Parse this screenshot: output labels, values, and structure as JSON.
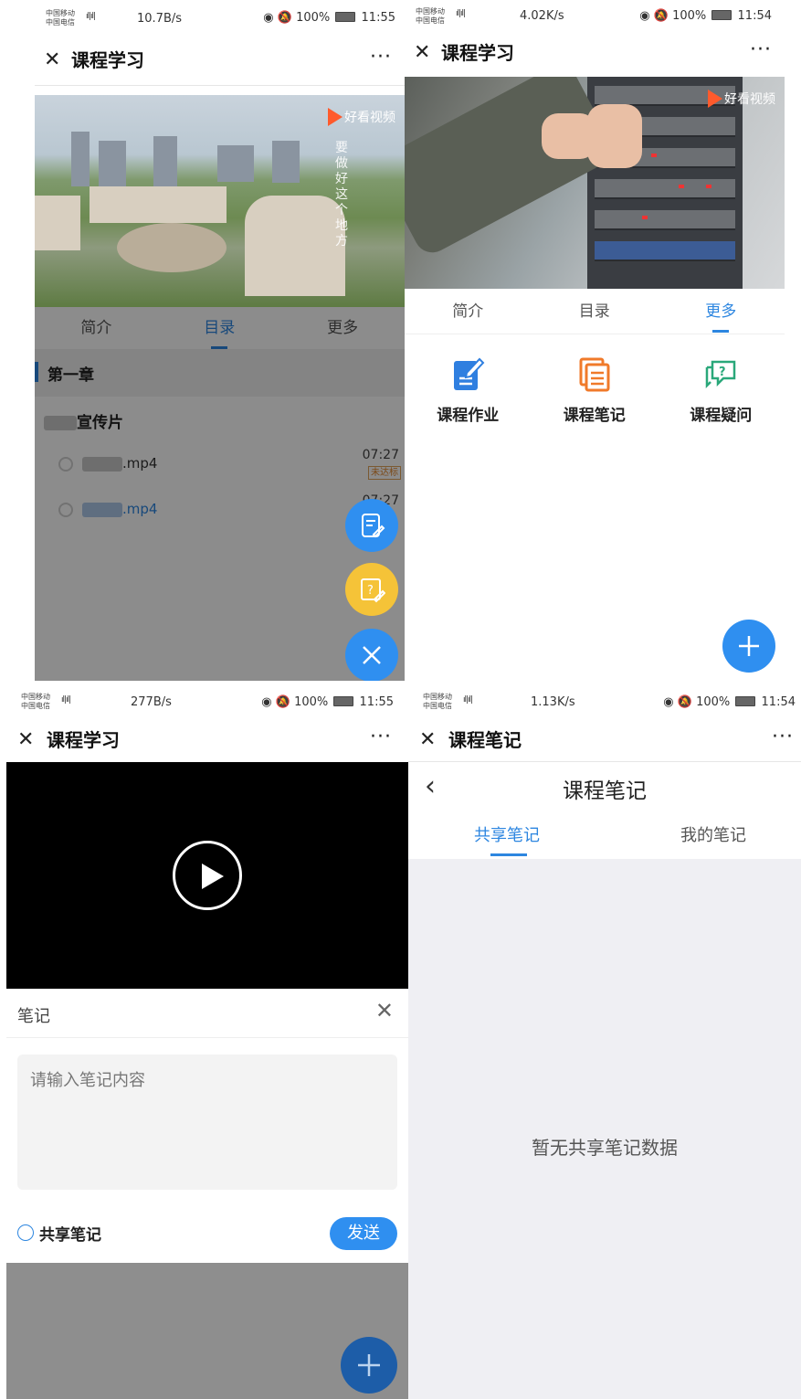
{
  "common": {
    "carrier_line1": "中国移动",
    "carrier_line2": "中国电信",
    "signal1": "2G",
    "signal2": "4G",
    "battery": "100%",
    "close_icon": "close-icon",
    "more_label": "···"
  },
  "panel1": {
    "speed": "10.7B/s",
    "time": "11:55",
    "title": "课程学习",
    "video_logo": "好看视频",
    "video_calligraphy": "要做好这个地方",
    "tabs": [
      {
        "label": "简介",
        "active": false
      },
      {
        "label": "目录",
        "active": true
      },
      {
        "label": "更多",
        "active": false
      }
    ],
    "chapter": "第一章",
    "section": "宣传片",
    "videos": [
      {
        "name": ".mp4",
        "duration": "07:27",
        "tag": "未达标"
      },
      {
        "name": ".mp4",
        "duration": "07:27",
        "tag": ""
      }
    ],
    "fab_icons": [
      "note-edit-icon",
      "question-edit-icon",
      "close-icon"
    ]
  },
  "panel2": {
    "speed": "4.02K/s",
    "time": "11:54",
    "title": "课程学习",
    "video_logo": "好看视频",
    "tabs": [
      {
        "label": "简介",
        "active": false
      },
      {
        "label": "目录",
        "active": false
      },
      {
        "label": "更多",
        "active": true
      }
    ],
    "features": [
      {
        "label": "课程作业",
        "icon": "homework-icon",
        "color": "#2f7fe0"
      },
      {
        "label": "课程笔记",
        "icon": "notes-icon",
        "color": "#f07a2a"
      },
      {
        "label": "课程疑问",
        "icon": "question-icon",
        "color": "#2aa87a"
      }
    ],
    "fab_icon": "plus-icon"
  },
  "panel3": {
    "speed": "277B/s",
    "time": "11:55",
    "title": "课程学习",
    "note_title": "笔记",
    "note_placeholder": "请输入笔记内容",
    "share_label": "共享笔记",
    "send_label": "发送",
    "fab_icon": "plus-icon"
  },
  "panel4": {
    "speed": "1.13K/s",
    "time": "11:54",
    "title": "课程笔记",
    "page_title": "课程笔记",
    "tabs": [
      {
        "label": "共享笔记",
        "active": true
      },
      {
        "label": "我的笔记",
        "active": false
      }
    ],
    "empty_text": "暂无共享笔记数据"
  },
  "colors": {
    "accent": "#2d86e0",
    "fab_blue": "#2f8ff0",
    "fab_yellow": "#f5c338",
    "tag_orange": "#e0862b"
  }
}
